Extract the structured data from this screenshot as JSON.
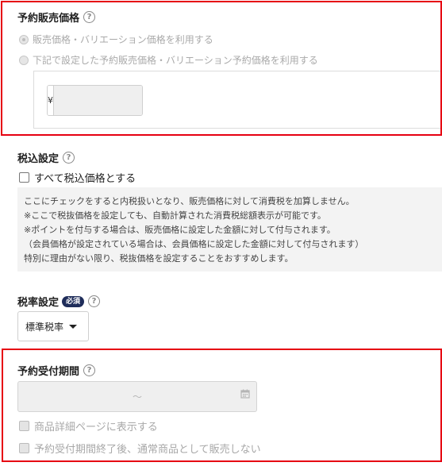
{
  "reservation_price": {
    "title": "予約販売価格",
    "option_1": "販売価格・バリエーション価格を利用する",
    "option_2": "下記で設定した予約販売価格・バリエーション予約価格を利用する",
    "currency_symbol": "¥",
    "price_value": ""
  },
  "tax_inclusive": {
    "title": "税込設定",
    "checkbox_label": "すべて税込価格とする",
    "notes": [
      "ここにチェックをすると内税扱いとなり、販売価格に対して消費税を加算しません。",
      "※ここで税抜価格を設定しても、自動計算された消費税総額表示が可能です。",
      "※ポイントを付与する場合は、販売価格に設定した金額に対して付与されます。",
      "（会員価格が設定されている場合は、会員価格に設定した金額に対して付与されます）",
      "特別に理由がない限り、税抜価格を設定することをおすすめします。"
    ]
  },
  "tax_rate": {
    "title": "税率設定",
    "required_badge": "必須",
    "selected": "標準税率"
  },
  "reservation_period": {
    "title": "予約受付期間",
    "range_separator": "～",
    "checkbox_1": "商品詳細ページに表示する",
    "checkbox_2": "予約受付期間終了後、通常商品として販売しない"
  },
  "help_glyph": "?",
  "icons": [
    "help-icon",
    "calendar-icon",
    "chevron-down-icon"
  ],
  "colors": {
    "highlight": "#e60012",
    "badge": "#1f2d5a"
  }
}
